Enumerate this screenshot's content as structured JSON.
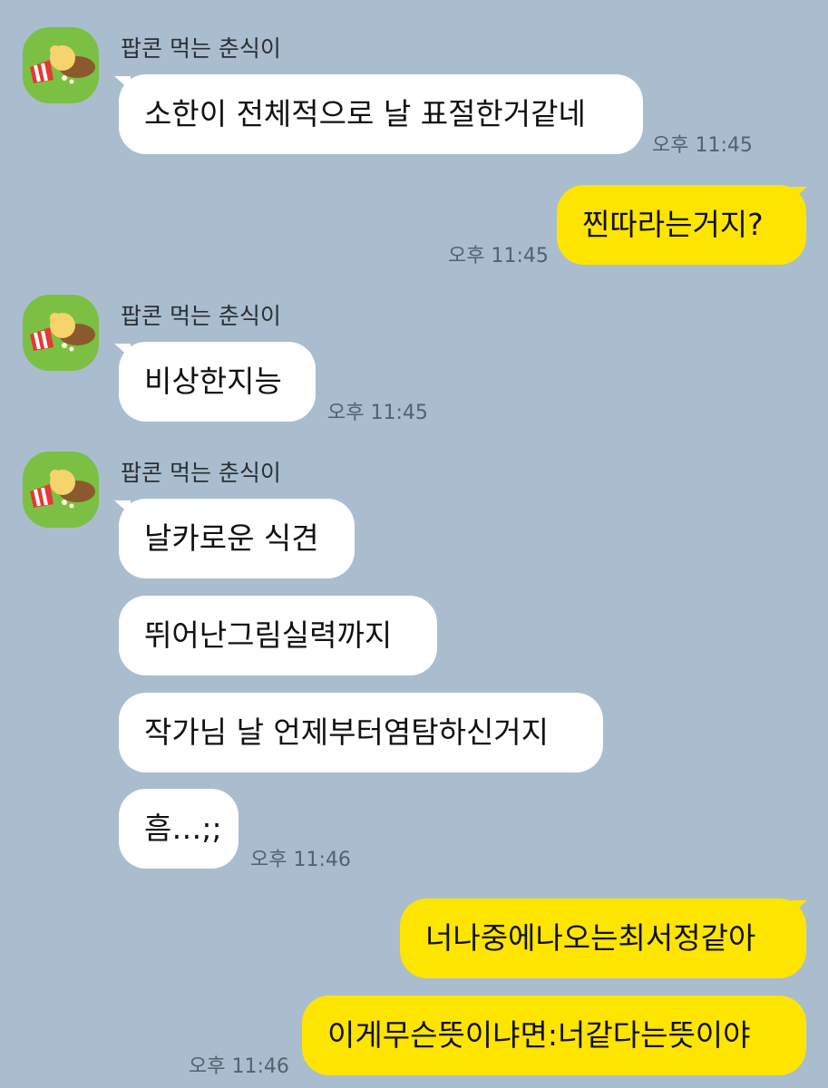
{
  "sender": {
    "name": "팝콘 먹는 춘식이"
  },
  "messages": [
    {
      "text": "소한이 전체적으로 날 표절한거같네",
      "time": "오후 11:45"
    },
    {
      "text": "찐따라는거지?",
      "time": "오후 11:45"
    },
    {
      "text": "비상한지능",
      "time": "오후 11:45"
    },
    {
      "text": "날카로운 식견"
    },
    {
      "text": "뛰어난그림실력까지"
    },
    {
      "text": "작가님 날 언제부터염탐하신거지"
    },
    {
      "text": "흠…;;",
      "time": "오후 11:46"
    },
    {
      "text": "너나중에나오는최서정같아"
    },
    {
      "text": "이게무슨뜻이냐면:너같다는뜻이야",
      "time": "오후 11:46"
    }
  ],
  "colors": {
    "background": "#a9bdce",
    "incoming_bubble": "#ffffff",
    "outgoing_bubble": "#fee500",
    "avatar_bg": "#7bc043"
  }
}
